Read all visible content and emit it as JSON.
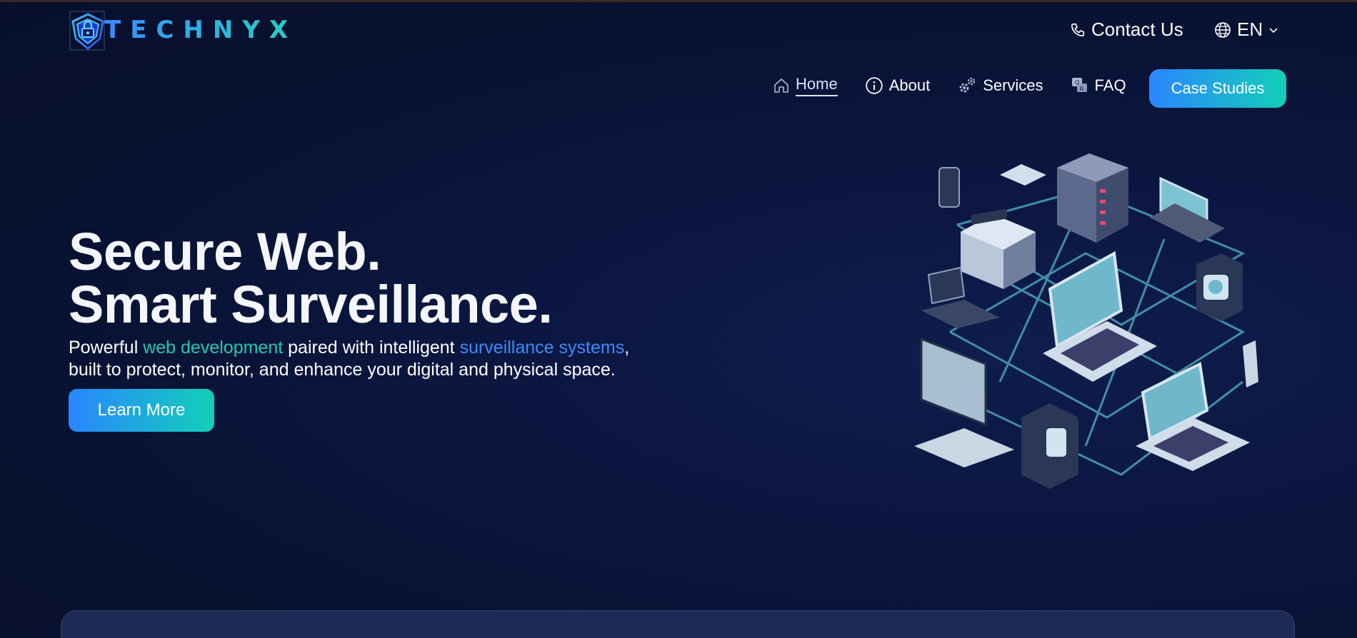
{
  "brand": {
    "name": "TECHNYX",
    "logo_icon": "shield-lock-logo"
  },
  "topbar": {
    "contact_label": "Contact Us",
    "contact_icon": "phone-icon",
    "language_label": "EN",
    "language_icon": "globe-icon"
  },
  "nav": {
    "items": [
      {
        "label": "Home",
        "icon": "home-icon",
        "active": true
      },
      {
        "label": "About",
        "icon": "info-icon",
        "active": false
      },
      {
        "label": "Services",
        "icon": "gears-icon",
        "active": false
      },
      {
        "label": "FAQ",
        "icon": "faq-icon",
        "active": false
      }
    ],
    "cta_label": "Case Studies"
  },
  "hero": {
    "title_line1": "Secure Web.",
    "title_line2": "Smart Surveillance.",
    "sub_pre": "Powerful ",
    "sub_hl1": "web development",
    "sub_mid": " paired with intelligent ",
    "sub_hl2": "surveillance systems",
    "sub_post": ",",
    "sub_line2": "built to protect, monitor, and enhance your digital and physical space.",
    "button_label": "Learn More"
  },
  "colors": {
    "accent_blue": "#2a86ff",
    "accent_teal": "#12cfb8",
    "highlight_green": "#22c9b0",
    "highlight_blue": "#3a8bff",
    "background": "#081232"
  }
}
